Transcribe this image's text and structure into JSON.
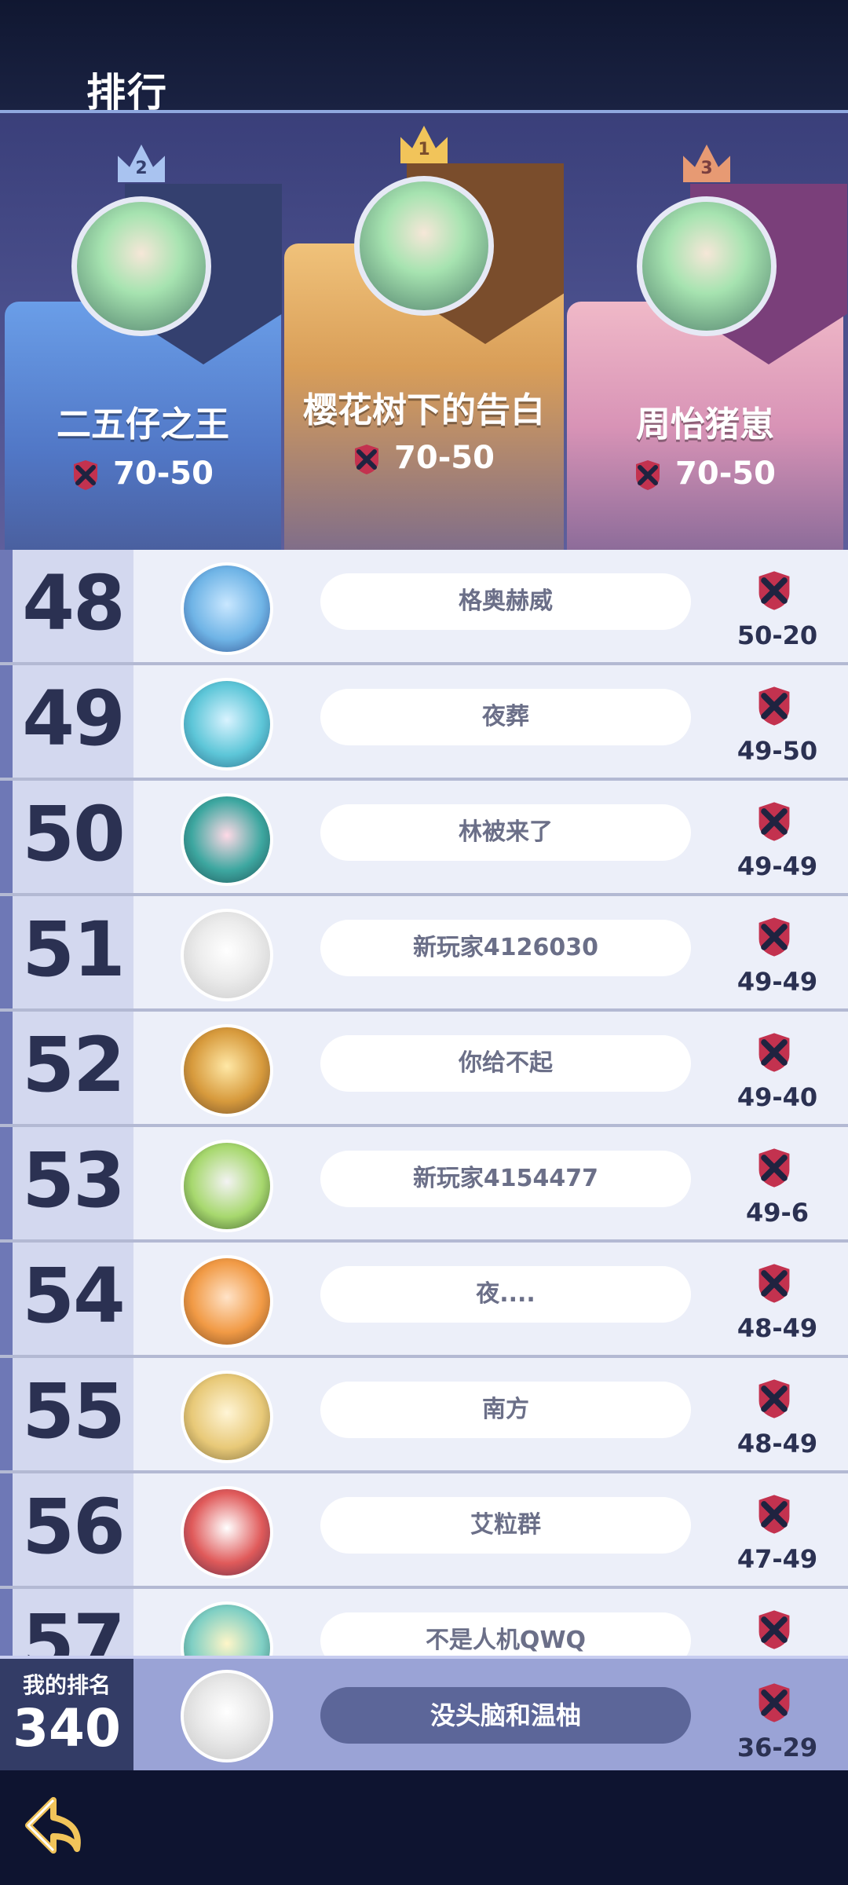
{
  "header": {
    "title": "排行"
  },
  "podium": {
    "first": {
      "rank": "1",
      "name": "樱花树下的告白",
      "score": "70-50"
    },
    "second": {
      "rank": "2",
      "name": "二五仔之王",
      "score": "70-50"
    },
    "third": {
      "rank": "3",
      "name": "周怡猪崽",
      "score": "70-50"
    }
  },
  "rows": [
    {
      "rank": "48",
      "name": "格奥赫威",
      "score": "50-20"
    },
    {
      "rank": "49",
      "name": "夜葬",
      "score": "49-50"
    },
    {
      "rank": "50",
      "name": "林被来了",
      "score": "49-49"
    },
    {
      "rank": "51",
      "name": "新玩家4126030",
      "score": "49-49"
    },
    {
      "rank": "52",
      "name": "你给不起",
      "score": "49-40"
    },
    {
      "rank": "53",
      "name": "新玩家4154477",
      "score": "49-6"
    },
    {
      "rank": "54",
      "name": "夜....",
      "score": "48-49"
    },
    {
      "rank": "55",
      "name": "南方",
      "score": "48-49"
    },
    {
      "rank": "56",
      "name": "艾粒群",
      "score": "47-49"
    },
    {
      "rank": "57",
      "name": "不是人机QWQ",
      "score": ""
    }
  ],
  "my_rank": {
    "label": "我的排名",
    "rank": "340",
    "name": "没头脑和温柚",
    "score": "36-29"
  },
  "colors": {
    "accent_first": "#d99e58",
    "accent_second": "#5177c6",
    "accent_third": "#d893b6"
  },
  "icons": {
    "back": "back-arrow-icon",
    "badge": "crossed-swords-shield-icon"
  }
}
